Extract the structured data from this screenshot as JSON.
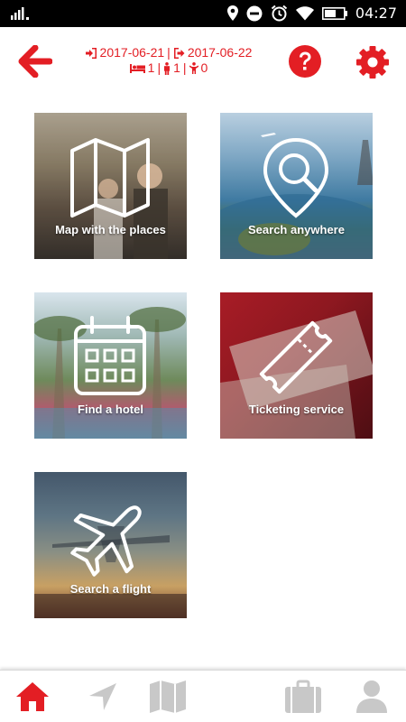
{
  "status_bar": {
    "time": "04:27"
  },
  "header": {
    "checkin_date": "2017-06-21",
    "separator": "|",
    "checkout_date": "2017-06-22",
    "rooms": "1",
    "adults": "1",
    "children": "0"
  },
  "tiles": [
    {
      "label": "Map with the places",
      "icon": "folded-map-icon"
    },
    {
      "label": "Search anywhere",
      "icon": "magnifier-pin-icon"
    },
    {
      "label": "Find a hotel",
      "icon": "calendar-icon"
    },
    {
      "label": "Ticketing service",
      "icon": "ticket-icon"
    },
    {
      "label": "Search a flight",
      "icon": "airplane-icon"
    }
  ],
  "bottom_nav": {
    "items": [
      "home-icon",
      "navigation-arrow-icon",
      "map-icon",
      "suitcase-icon",
      "profile-icon"
    ],
    "active": "home-icon"
  },
  "colors": {
    "accent": "#e31e24",
    "inactive_nav": "#c8c8c8",
    "status_bar": "#000000"
  }
}
